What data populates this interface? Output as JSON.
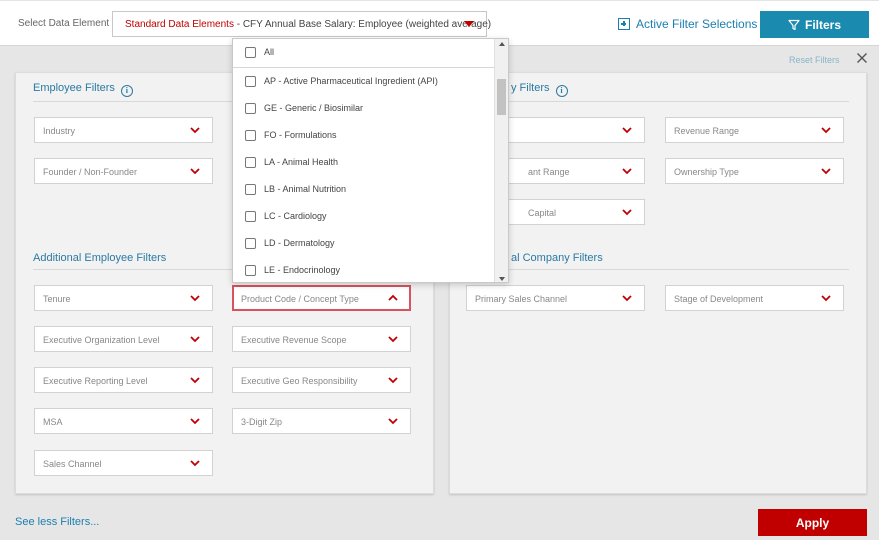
{
  "topbar": {
    "select_label": "Select Data Element",
    "selected_prefix": "Standard Data Elements",
    "selected_rest": " - CFY Annual Base Salary: Employee (weighted average)",
    "active_filter_label": "Active Filter Selections",
    "filters_button": "Filters"
  },
  "panel_controls": {
    "reset_label": "Reset Filters"
  },
  "employee_filters": {
    "title": "Employee Filters",
    "fields": [
      "Industry",
      "Founder / Non-Founder"
    ]
  },
  "company_filters": {
    "title_visible": "y Filters",
    "fields_visible": [
      "",
      "ant Range",
      "Capital"
    ],
    "right_fields": [
      "Revenue Range",
      "Ownership Type"
    ]
  },
  "additional_employee": {
    "title": "Additional Employee Filters",
    "left_fields": [
      "Tenure",
      "Executive Organization Level",
      "Executive Reporting Level",
      "MSA",
      "Sales Channel"
    ],
    "right_fields": [
      "Product Code / Concept Type",
      "Executive Revenue Scope",
      "Executive Geo Responsibility",
      "3-Digit Zip"
    ]
  },
  "additional_company": {
    "title_visible": "al Company Filters",
    "fields": [
      "Primary Sales Channel",
      "Stage of Development"
    ]
  },
  "dropdown": {
    "all_label": "All",
    "items": [
      "AP - Active Pharmaceutical Ingredient (API)",
      "GE - Generic / Biosimilar",
      "FO - Formulations",
      "LA - Animal Health",
      "LB - Animal Nutrition",
      "LC - Cardiology",
      "LD - Dermatology",
      "LE - Endocrinology"
    ]
  },
  "footer": {
    "see_less": "See less Filters...",
    "apply": "Apply"
  },
  "colors": {
    "accent_blue": "#1a8aaf",
    "brand_red": "#c00000",
    "highlight_red": "#d9535f"
  }
}
